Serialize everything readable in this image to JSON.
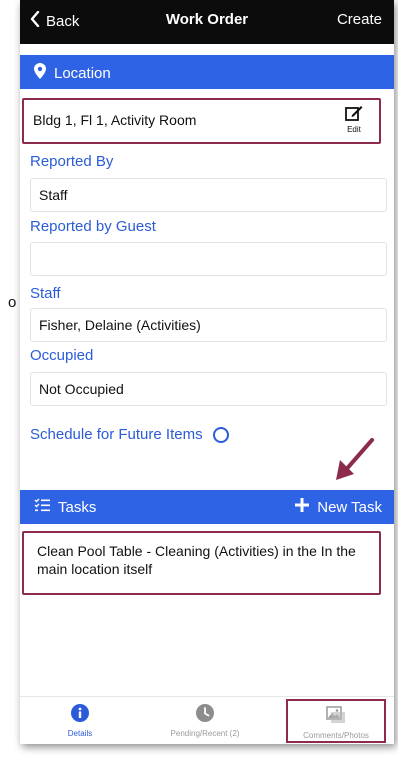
{
  "navbar": {
    "back_label": "Back",
    "title": "Work Order",
    "create_label": "Create"
  },
  "location_section": {
    "label": "Location",
    "value": "Bldg 1, Fl 1, Activity Room",
    "edit_label": "Edit"
  },
  "fields": {
    "reported_by": {
      "label": "Reported By",
      "value": "Staff"
    },
    "reported_by_guest": {
      "label": "Reported by Guest",
      "value": ""
    },
    "staff": {
      "label": "Staff",
      "value": "Fisher, Delaine (Activities)"
    },
    "occupied": {
      "label": "Occupied",
      "value": "Not Occupied"
    }
  },
  "schedule": {
    "label": "Schedule for Future Items",
    "checked": false
  },
  "tasks_section": {
    "label": "Tasks",
    "new_task_label": "New Task"
  },
  "tasks": [
    {
      "text": "Clean Pool Table - Cleaning (Activities) in the In the main location itself"
    }
  ],
  "tabs": [
    {
      "label": "Details",
      "active": true,
      "icon": "info-icon"
    },
    {
      "label": "Pending/Recent (2)",
      "active": false,
      "icon": "clock-icon"
    },
    {
      "label": "Comments/Photos",
      "active": false,
      "icon": "photos-icon"
    }
  ],
  "stray_text": "o",
  "colors": {
    "accent_blue": "#2f63e6",
    "label_blue": "#2b5bd8",
    "highlight_border": "#8c2b4c",
    "navbar_bg": "#0c0c0c"
  }
}
